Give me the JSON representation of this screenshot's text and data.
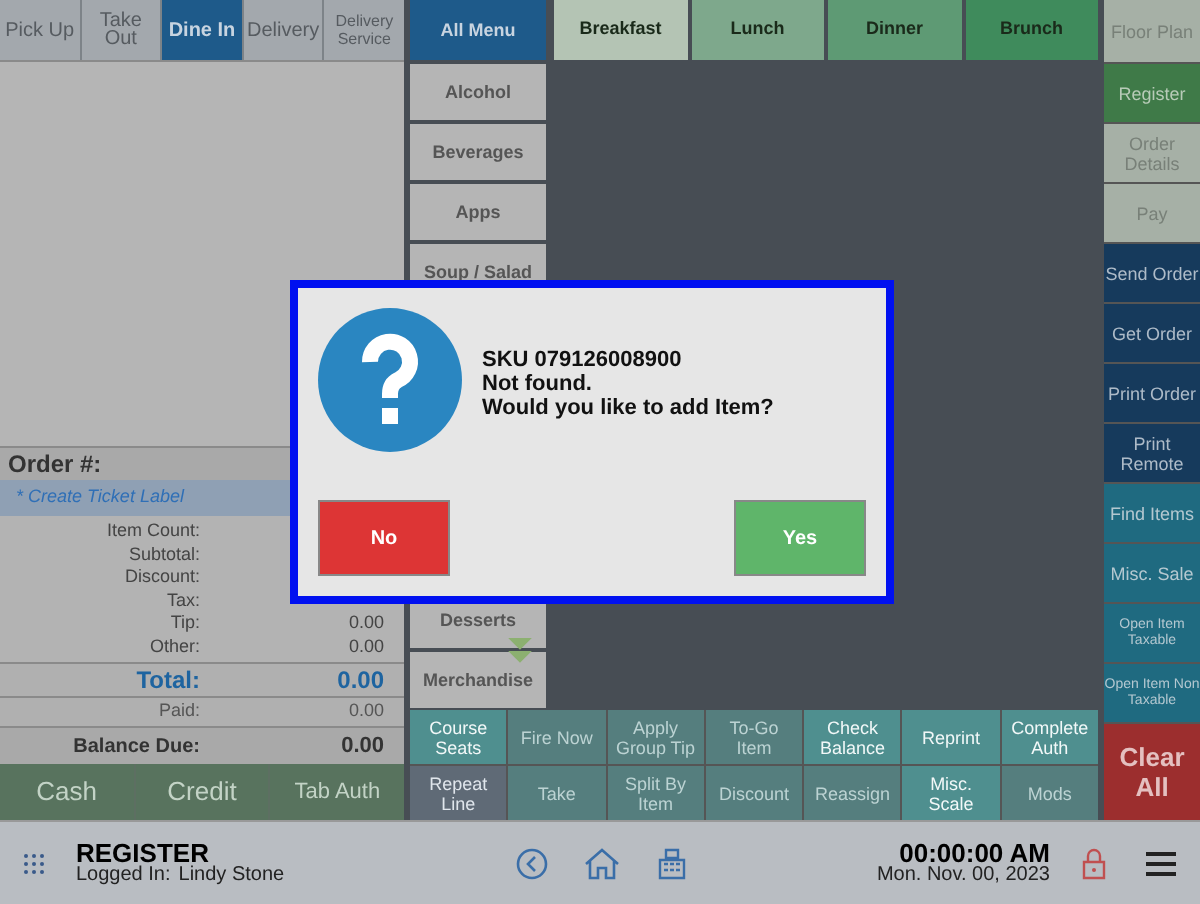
{
  "order_types": [
    {
      "label": "Pick Up",
      "selected": false,
      "disabled": true
    },
    {
      "label": "Take Out",
      "selected": false,
      "disabled": true
    },
    {
      "label": "Dine In",
      "selected": true,
      "disabled": false
    },
    {
      "label": "Delivery",
      "selected": false,
      "disabled": true
    },
    {
      "label": "Delivery Service",
      "selected": false,
      "disabled": true
    }
  ],
  "order": {
    "title": "Order #:",
    "ticket_label": "* Create Ticket Label",
    "summary": [
      {
        "label": "Item Count:"
      },
      {
        "label": "Subtotal:"
      },
      {
        "label": "Discount:"
      },
      {
        "label": "Tax:"
      },
      {
        "label": "Tip:",
        "value": "0.00"
      },
      {
        "label": "Other:",
        "value": "0.00"
      }
    ],
    "total": {
      "label": "Total:",
      "value": "0.00"
    },
    "paid": {
      "label": "Paid:",
      "value": "0.00"
    },
    "balance_due": {
      "label": "Balance Due:",
      "value": "0.00"
    }
  },
  "payment_buttons": [
    {
      "label": "Cash",
      "disabled": true
    },
    {
      "label": "Credit",
      "disabled": true
    },
    {
      "label": "Tab Auth",
      "disabled": true
    }
  ],
  "categories_top": [
    {
      "label": "All Menu",
      "selected": true
    },
    {
      "label": "Alcohol",
      "selected": false
    },
    {
      "label": "Beverages",
      "selected": false
    },
    {
      "label": "Apps",
      "selected": false
    },
    {
      "label": "Soup / Salad",
      "selected": false
    }
  ],
  "categories_bottom": [
    {
      "label": "Desserts",
      "selected": false
    },
    {
      "label": "Merchandise",
      "selected": false
    }
  ],
  "menu_tabs": [
    {
      "label": "Breakfast",
      "color": "#b4c4b4"
    },
    {
      "label": "Lunch",
      "color": "#7ea88c"
    },
    {
      "label": "Dinner",
      "color": "#5e9a74"
    },
    {
      "label": "Brunch",
      "color": "#3f8b5c"
    }
  ],
  "functions": [
    {
      "label": "Course Seats",
      "disabled": false
    },
    {
      "label": "Fire Now",
      "disabled": true
    },
    {
      "label": "Apply Group Tip",
      "disabled": true
    },
    {
      "label": "To-Go Item",
      "disabled": true
    },
    {
      "label": "Check Balance",
      "disabled": false
    },
    {
      "label": "Reprint",
      "disabled": false
    },
    {
      "label": "Complete Auth",
      "disabled": false
    },
    {
      "label": "Repeat Line",
      "disabled": false,
      "kind": "slate"
    },
    {
      "label": "Take",
      "disabled": true
    },
    {
      "label": "Split By Item",
      "disabled": true
    },
    {
      "label": "Discount",
      "disabled": true
    },
    {
      "label": "Reassign",
      "disabled": true
    },
    {
      "label": "Misc. Scale",
      "disabled": false
    },
    {
      "label": "Mods",
      "disabled": true
    }
  ],
  "side_buttons": [
    {
      "label": "Floor Plan",
      "kind": "gray"
    },
    {
      "label": "Register",
      "kind": "green"
    },
    {
      "label": "Order Details",
      "kind": "gray"
    },
    {
      "label": "Pay",
      "kind": "gray"
    },
    {
      "label": "Send Order",
      "kind": "navy"
    },
    {
      "label": "Get Order",
      "kind": "navy"
    },
    {
      "label": "Print Order",
      "kind": "navy"
    },
    {
      "label": "Print Remote",
      "kind": "navy"
    },
    {
      "label": "Find Items",
      "kind": "teal"
    },
    {
      "label": "Misc. Sale",
      "kind": "teal"
    },
    {
      "label": "Open Item Taxable",
      "kind": "teal"
    },
    {
      "label": "Open Item Non Taxable",
      "kind": "teal"
    },
    {
      "label": "Clear All",
      "kind": "red"
    }
  ],
  "status_bar": {
    "title": "REGISTER",
    "logged_in_label": "Logged In:",
    "user": "Lindy Stone",
    "time": "00:00:00 AM",
    "date": "Mon. Nov. 00, 2023"
  },
  "dialog": {
    "lines": [
      "SKU 079126008900",
      "Not found.",
      "Would you like to add Item?"
    ],
    "buttons": [
      {
        "label": "No",
        "kind": "no"
      },
      {
        "label": "Yes",
        "kind": "yes"
      }
    ]
  }
}
